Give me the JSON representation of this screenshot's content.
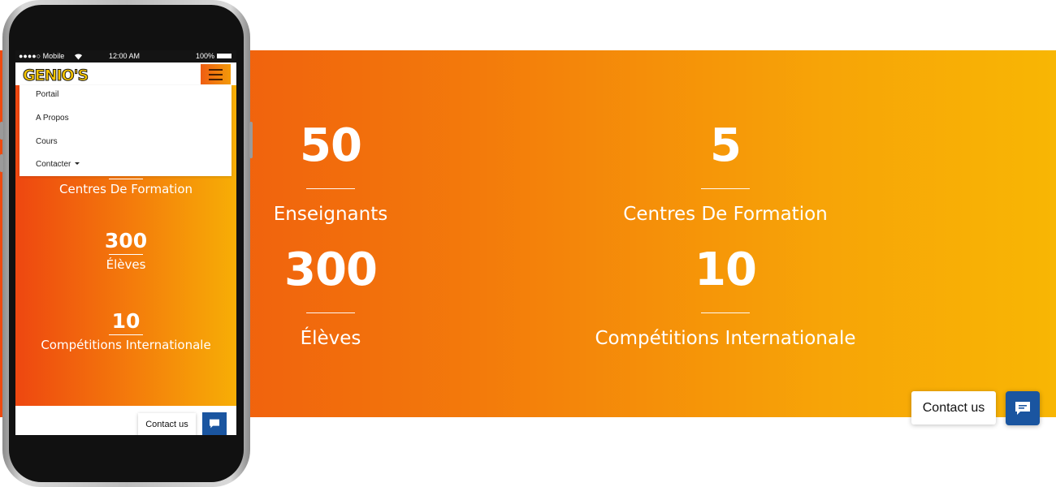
{
  "stats": [
    {
      "number": "50",
      "label": "Enseignants"
    },
    {
      "number": "5",
      "label": "Centres De Formation"
    },
    {
      "number": "300",
      "label": "Élèves"
    },
    {
      "number": "10",
      "label": "Compétitions Internationale"
    }
  ],
  "contact": {
    "label": "Contact us",
    "icon": "chat-icon"
  },
  "phone": {
    "status": {
      "carrier": "●●●●○ Mobile",
      "wifi_icon": "wifi-icon",
      "time": "12:00 AM",
      "battery": "100%"
    },
    "logo_text": "GENIO'S",
    "menu": [
      {
        "label": "Portail"
      },
      {
        "label": "A Propos"
      },
      {
        "label": "Cours"
      },
      {
        "label": "Contacter",
        "dropdown": true
      }
    ],
    "stats": [
      {
        "label": "Centres De Formation"
      },
      {
        "number": "300",
        "label": "Élèves"
      },
      {
        "number": "10",
        "label": "Compétitions Internationale"
      }
    ],
    "contact_label": "Contact us"
  },
  "colors": {
    "band_start": "#ee4a10",
    "band_end": "#f8b604",
    "chat_button": "#1a55a0",
    "logo_yellow": "#f5c400"
  }
}
